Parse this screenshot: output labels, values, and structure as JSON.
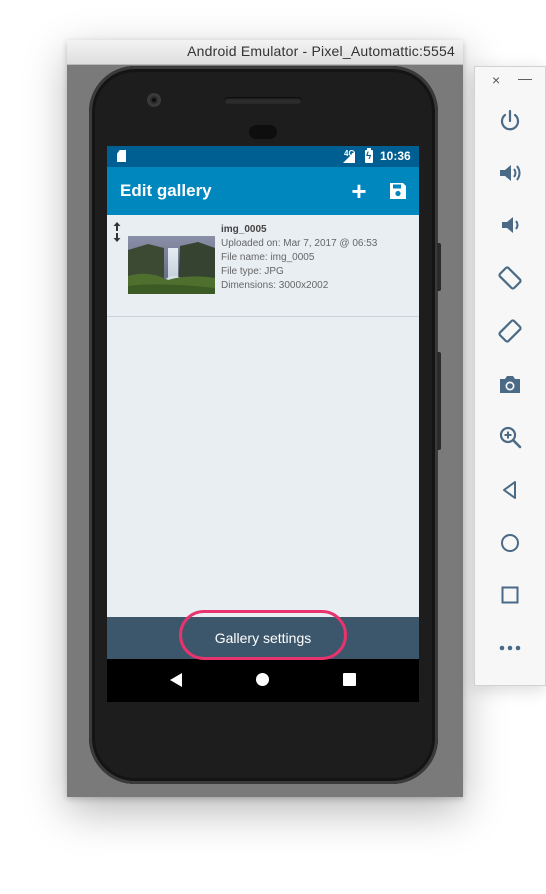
{
  "window": {
    "title": "Android Emulator - Pixel_Automattic:5554"
  },
  "statusbar": {
    "network": "4G",
    "time": "10:36"
  },
  "appbar": {
    "title": "Edit gallery",
    "add_icon": "plus-icon",
    "save_icon": "floppy-save-icon"
  },
  "items": [
    {
      "title": "img_0005",
      "uploaded": "Uploaded on: Mar 7, 2017 @ 06:53",
      "file_name": "File name: img_0005",
      "file_type": "File type: JPG",
      "dimensions": "Dimensions: 3000x2002"
    }
  ],
  "bottom": {
    "settings_label": "Gallery settings"
  },
  "colors": {
    "statusbar": "#005f92",
    "appbar": "#0087be",
    "bottombar": "#3c576c",
    "highlight": "#e8336f",
    "screen_bg": "#e9eef3"
  },
  "emulator_toolbar": {
    "buttons": [
      "power-icon",
      "volume-up-icon",
      "volume-down-icon",
      "rotate-left-icon",
      "rotate-right-icon",
      "camera-icon",
      "zoom-icon",
      "back-icon",
      "home-icon",
      "overview-icon",
      "more-icon"
    ]
  }
}
